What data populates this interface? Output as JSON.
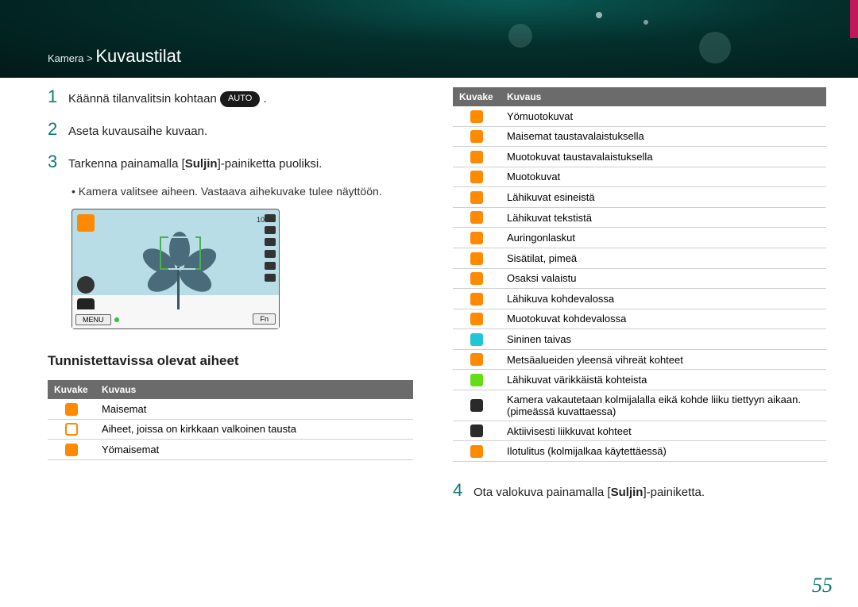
{
  "breadcrumb": {
    "section": "Kamera",
    "separator": ">",
    "title": "Kuvaustilat"
  },
  "steps": {
    "s1_num": "1",
    "s1_text": "Käännä tilanvalitsin kohtaan ",
    "s1_badge": "AUTO",
    "s1_tail": " .",
    "s2_num": "2",
    "s2_text": "Aseta kuvausaihe kuvaan.",
    "s3_num": "3",
    "s3_pre": "Tarkenna painamalla [",
    "s3_bold": "Suljin",
    "s3_post": "]-painiketta puoliksi.",
    "s3_bullet": "Kamera valitsee aiheen. Vastaava aihekuvake tulee näyttöön.",
    "s4_num": "4",
    "s4_pre": "Ota valokuva painamalla [",
    "s4_bold": "Suljin",
    "s4_post": "]-painiketta."
  },
  "preview": {
    "topright_count": "10",
    "menu_label": "MENU",
    "fn_label": "Fn"
  },
  "subheading": "Tunnistettavissa olevat aiheet",
  "tableLeft": {
    "h1": "Kuvake",
    "h2": "Kuvaus",
    "rows": [
      {
        "icon": "ic-orange",
        "desc": "Maisemat"
      },
      {
        "icon": "ic-orange-outline",
        "desc": "Aiheet, joissa on kirkkaan valkoinen tausta"
      },
      {
        "icon": "ic-orange",
        "desc": "Yömaisemat"
      }
    ]
  },
  "tableRight": {
    "h1": "Kuvake",
    "h2": "Kuvaus",
    "rows": [
      {
        "icon": "ic-orange",
        "desc": "Yömuotokuvat"
      },
      {
        "icon": "ic-orange",
        "desc": "Maisemat taustavalaistuksella"
      },
      {
        "icon": "ic-orange",
        "desc": "Muotokuvat taustavalaistuksella"
      },
      {
        "icon": "ic-orange",
        "desc": "Muotokuvat"
      },
      {
        "icon": "ic-orange",
        "desc": "Lähikuvat esineistä"
      },
      {
        "icon": "ic-orange",
        "desc": "Lähikuvat tekstistä"
      },
      {
        "icon": "ic-orange",
        "desc": "Auringonlaskut"
      },
      {
        "icon": "ic-orange",
        "desc": "Sisätilat, pimeä"
      },
      {
        "icon": "ic-orange",
        "desc": "Osaksi valaistu"
      },
      {
        "icon": "ic-orange",
        "desc": "Lähikuva kohdevalossa"
      },
      {
        "icon": "ic-orange",
        "desc": "Muotokuvat kohdevalossa"
      },
      {
        "icon": "ic-cyan",
        "desc": "Sininen taivas"
      },
      {
        "icon": "ic-orange",
        "desc": "Metsäalueiden yleensä vihreät kohteet"
      },
      {
        "icon": "ic-green",
        "desc": "Lähikuvat värikkäistä kohteista"
      },
      {
        "icon": "ic-dark",
        "desc": "Kamera vakautetaan kolmijalalla eikä kohde liiku tiettyyn aikaan. (pimeässä kuvattaessa)"
      },
      {
        "icon": "ic-dark",
        "desc": "Aktiivisesti liikkuvat kohteet"
      },
      {
        "icon": "ic-orange",
        "desc": "Ilotulitus (kolmijalkaa käytettäessä)"
      }
    ]
  },
  "pageNumber": "55"
}
